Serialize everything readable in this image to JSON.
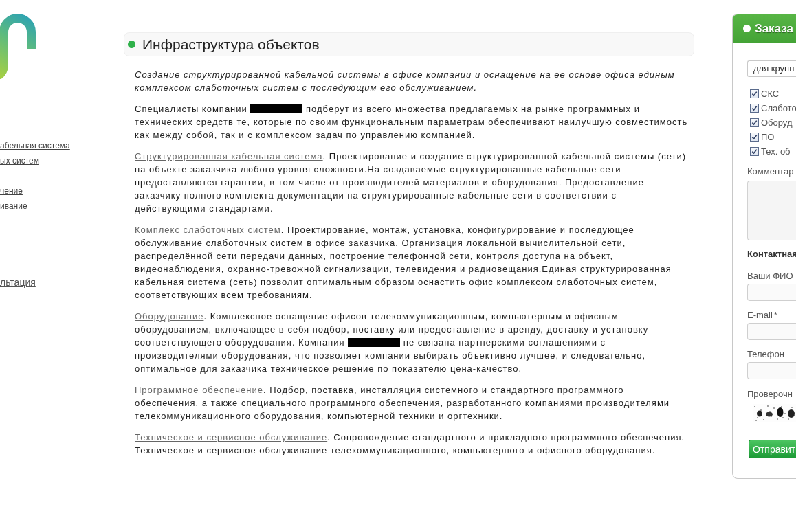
{
  "sidebar": {
    "groups": [
      {
        "items": [
          {
            "label": "абельная система",
            "kind": "sub"
          },
          {
            "label": "ых систем",
            "kind": "sub"
          }
        ]
      },
      {
        "items": [
          {
            "label": "чение",
            "kind": "sub"
          },
          {
            "label": "ивание",
            "kind": "sub"
          }
        ]
      },
      {
        "items": [
          {
            "label": "льтация",
            "kind": "main"
          }
        ]
      }
    ]
  },
  "content": {
    "title": "Инфраструктура объектов",
    "intro": "Создание структурированной кабельной системы в офисе компании и оснащение на ее основе офиса единым комплексом слаботочных систем с последующим его обслуживанием.",
    "paragraphs": [
      {
        "segments": [
          {
            "kind": "text",
            "text": "Специалисты компании "
          },
          {
            "kind": "redacted"
          },
          {
            "kind": "text",
            "text": " подберут из всего множества предлагаемых на рынке программных и технических средств те, которые по своим функциональным параметрам обеспечивают наилучшую совместимость как между собой, так и с комплексом задач по управлению компанией."
          }
        ]
      },
      {
        "segments": [
          {
            "kind": "link",
            "text": "Структурированная кабельная система"
          },
          {
            "kind": "text",
            "text": ". Проектирование и создание структурированной кабельной системы (сети) на объекте заказчика любого уровня сложности.На создаваемые структурированные кабельные сети предоставляются гарантии, в том числе от производителей материалов и оборудования. Предоставление заказчику полного комплекта документации на структурированные кабельные сети в соответствии с действующими стандартами."
          }
        ]
      },
      {
        "segments": [
          {
            "kind": "link",
            "text": "Комплекс слаботочных систем"
          },
          {
            "kind": "text",
            "text": ". Проектирование, монтаж, установка, конфигурирование и последующее обслуживание слаботочных систем в офисе заказчика. Организация локальной вычислительной сети, распределённой сети передачи данных, построение телефонной сети, контроля доступа на объект, видеонаблюдения, охранно-тревожной сигнализации, телевидения и радиовещания.Единая структурированная кабельная система (сеть) позволит оптимальным образом оснастить офис комплексом слаботочных систем, соответствующих всем требованиям."
          }
        ]
      },
      {
        "segments": [
          {
            "kind": "link",
            "text": "Оборудование"
          },
          {
            "kind": "text",
            "text": ". Комплексное оснащение офисов телекоммуникационным, компьютерным и офисным оборудованием, включающее в себя подбор, поставку или предоставление в аренду, доставку и установку соответствующего оборудования. Компания "
          },
          {
            "kind": "redacted"
          },
          {
            "kind": "text",
            "text": " не связана партнерскими соглашениями с производителями оборудования, что позволяет компании выбирать объективно лучшее, и следовательно, оптимальное для заказчика техническое решение по показателю цена-качество."
          }
        ]
      },
      {
        "segments": [
          {
            "kind": "link",
            "text": "Программное обеспечение"
          },
          {
            "kind": "text",
            "text": ". Подбор, поставка, инсталляция системного и стандартного программного обеспечения, а также специального программного обеспечения, разработанного компаниями производителями телекоммуникационного оборудования, компьютерной техники и оргтехники."
          }
        ]
      },
      {
        "segments": [
          {
            "kind": "link",
            "text": "Техническое и сервисное обслуживание"
          },
          {
            "kind": "text",
            "text": ". Сопровождение стандартного и прикладного программного обеспечения. Техническое и сервисное обслуживание телекоммуникационного, компьютерного и офисного оборудования."
          }
        ]
      }
    ]
  },
  "order_panel": {
    "title": "Заказа",
    "select": {
      "value": "для крупн"
    },
    "options": [
      {
        "label": "СКС",
        "checked": true
      },
      {
        "label": "Слабото",
        "checked": true
      },
      {
        "label": "Оборуд",
        "checked": true
      },
      {
        "label": "ПО",
        "checked": true
      },
      {
        "label": "Тех. об",
        "checked": true
      }
    ],
    "comment": {
      "label": "Комментар"
    },
    "contact_heading": "Контактная",
    "fields": [
      {
        "label": "Ваши ФИО"
      },
      {
        "label": "E-mail",
        "mark": "*"
      },
      {
        "label": "Телефон"
      }
    ],
    "captcha": {
      "label": "Проверочн"
    },
    "submit": "Отправит"
  }
}
